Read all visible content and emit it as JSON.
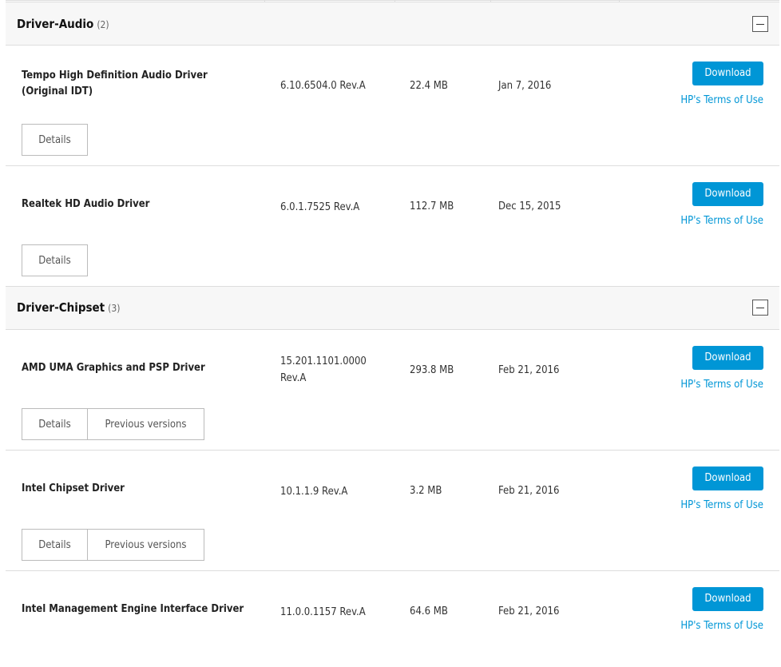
{
  "categories": [
    {
      "name": "Driver-Audio",
      "count": "(2)",
      "drivers": [
        {
          "name": "Tempo High Definition Audio Driver (Original IDT)",
          "version": "6.10.6504.0 Rev.A",
          "size": "22.4 MB",
          "date": "Jan 7, 2016",
          "buttons": [
            "Details"
          ]
        },
        {
          "name": "Realtek HD Audio Driver",
          "version": "6.0.1.7525 Rev.A",
          "size": "112.7 MB",
          "date": "Dec 15, 2015",
          "buttons": [
            "Details"
          ]
        }
      ]
    },
    {
      "name": "Driver-Chipset",
      "count": "(3)",
      "drivers": [
        {
          "name": "AMD UMA Graphics and PSP Driver",
          "version": "15.201.1101.0000 Rev.A",
          "size": "293.8 MB",
          "date": "Feb 21, 2016",
          "buttons": [
            "Details",
            "Previous versions"
          ]
        },
        {
          "name": "Intel Chipset Driver",
          "version": "10.1.1.9 Rev.A",
          "size": "3.2 MB",
          "date": "Feb 21, 2016",
          "buttons": [
            "Details",
            "Previous versions"
          ]
        },
        {
          "name": "Intel Management Engine Interface Driver",
          "version": "11.0.0.1157 Rev.A",
          "size": "64.6 MB",
          "date": "Feb 21, 2016",
          "buttons": []
        }
      ]
    }
  ],
  "common": {
    "download_label": "Download",
    "terms_label": "HP's Terms of Use"
  },
  "colors": {
    "accent": "#0096d6",
    "category_bg": "#f7f7f7",
    "border": "#dddddd"
  }
}
